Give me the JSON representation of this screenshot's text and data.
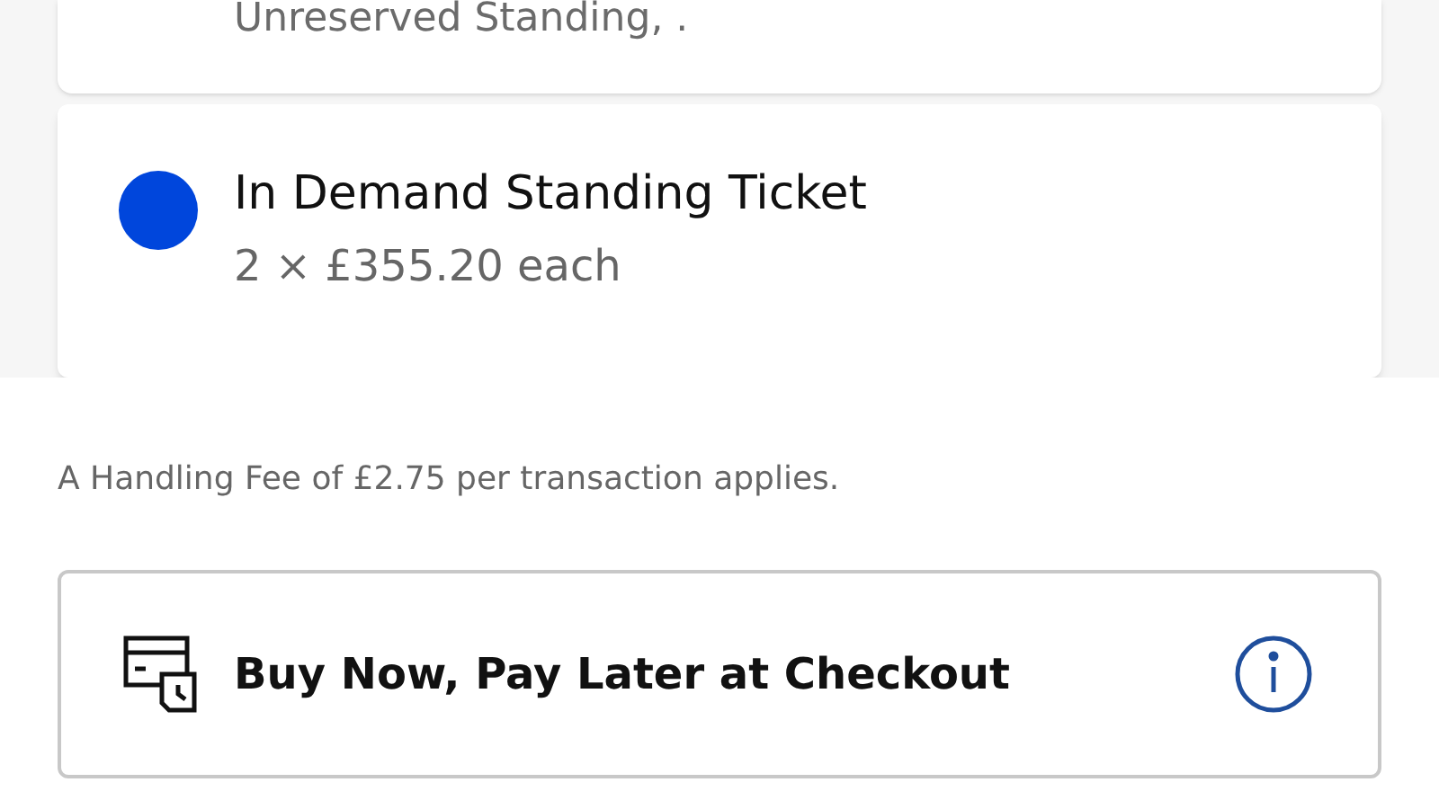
{
  "previous_ticket": {
    "description": "Unreserved Standing, ."
  },
  "ticket": {
    "color": "#0046dc",
    "name": "In Demand Standing Ticket",
    "price": "2 × £355.20 each"
  },
  "fee_notice": "A Handling Fee of £2.75 per transaction applies.",
  "payment_option": {
    "label": "Buy Now, Pay Later at Checkout"
  }
}
